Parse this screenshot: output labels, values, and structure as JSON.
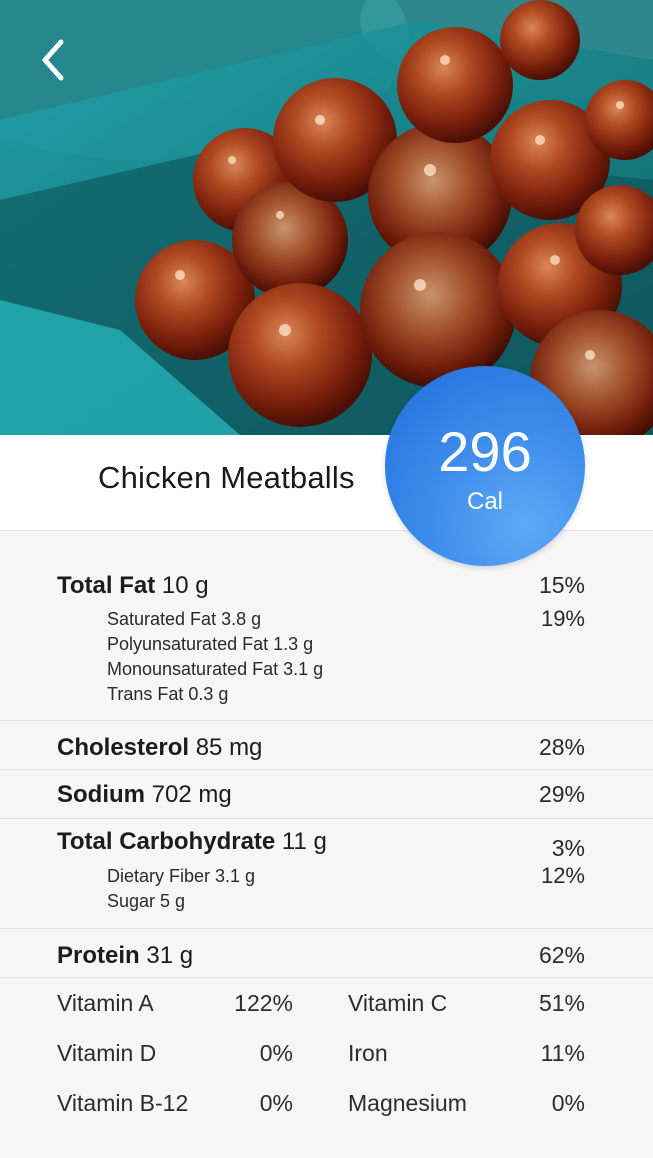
{
  "header": {
    "back_icon": "chevron-left-icon",
    "image_description_icon": "food-photo"
  },
  "recipe": {
    "title": "Chicken Meatballs",
    "calories_value": "296",
    "calories_unit": "Cal"
  },
  "colors": {
    "accent": "#2e7ee6",
    "accent_light": "#5fa9f5",
    "background": "#f6f6f6"
  },
  "nutrition": {
    "total_fat": {
      "label": "Total Fat",
      "amount": "10 g",
      "percent": "15%",
      "sub": [
        {
          "label": "Saturated Fat 3.8 g",
          "percent": "19%"
        },
        {
          "label": "Polyunsaturated Fat 1.3 g",
          "percent": ""
        },
        {
          "label": "Monounsaturated Fat 3.1 g",
          "percent": ""
        },
        {
          "label": "Trans Fat 0.3 g",
          "percent": ""
        }
      ]
    },
    "cholesterol": {
      "label": "Cholesterol",
      "amount": "85 mg",
      "percent": "28%"
    },
    "sodium": {
      "label": "Sodium",
      "amount": "702 mg",
      "percent": "29%"
    },
    "total_carbohydrate": {
      "label": "Total Carbohydrate",
      "amount": "11 g",
      "percent": "3%",
      "sub": [
        {
          "label": "Dietary Fiber 3.1 g",
          "percent": "12%"
        },
        {
          "label": "Sugar 5 g",
          "percent": ""
        }
      ]
    },
    "protein": {
      "label": "Protein",
      "amount": "31 g",
      "percent": "62%"
    }
  },
  "vitamins": [
    {
      "label": "Vitamin A",
      "value": "122%"
    },
    {
      "label": "Vitamin C",
      "value": "51%"
    },
    {
      "label": "Vitamin D",
      "value": "0%"
    },
    {
      "label": "Iron",
      "value": "11%"
    },
    {
      "label": "Vitamin B-12",
      "value": "0%"
    },
    {
      "label": "Magnesium",
      "value": "0%"
    }
  ]
}
